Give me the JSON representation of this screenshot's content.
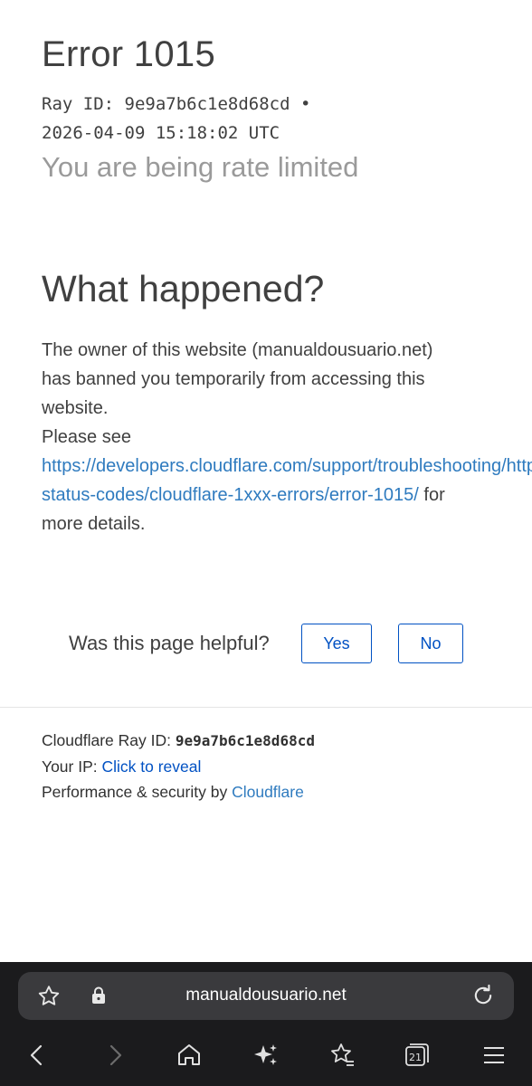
{
  "error": {
    "title": "Error 1015",
    "ray_line1": "Ray ID: 9e9a7b6c1e8d68cd •",
    "ray_line2": "2026-04-09 15:18:02 UTC",
    "subtitle": "You are being rate limited"
  },
  "what_happened": {
    "heading": "What happened?",
    "line1": "The owner of this website (manualdousuario.net)",
    "line2": "has banned you temporarily from accessing this",
    "line3": "website.",
    "line4": "Please see",
    "link_part1": "https://developers.cloudflare.com/support/troubleshooting/http-",
    "link_part2": "status-codes/cloudflare-1xxx-errors/error-1015/",
    "after_link": " for",
    "line7": "more details."
  },
  "feedback": {
    "question": "Was this page helpful?",
    "yes_label": "Yes",
    "no_label": "No"
  },
  "footer": {
    "ray_label": "Cloudflare Ray ID: ",
    "ray_value": "9e9a7b6c1e8d68cd",
    "ip_label": "Your IP: ",
    "ip_link": "Click to reveal",
    "perf_label": "Performance & security by ",
    "perf_link": "Cloudflare"
  },
  "browser": {
    "url": "manualdousuario.net",
    "tab_count": "21",
    "icons": [
      "star-icon",
      "lock-icon",
      "reload-icon",
      "back-icon",
      "forward-icon",
      "home-icon",
      "sparkle-icon",
      "bookmarks-icon",
      "tabs-icon",
      "menu-icon"
    ]
  }
}
